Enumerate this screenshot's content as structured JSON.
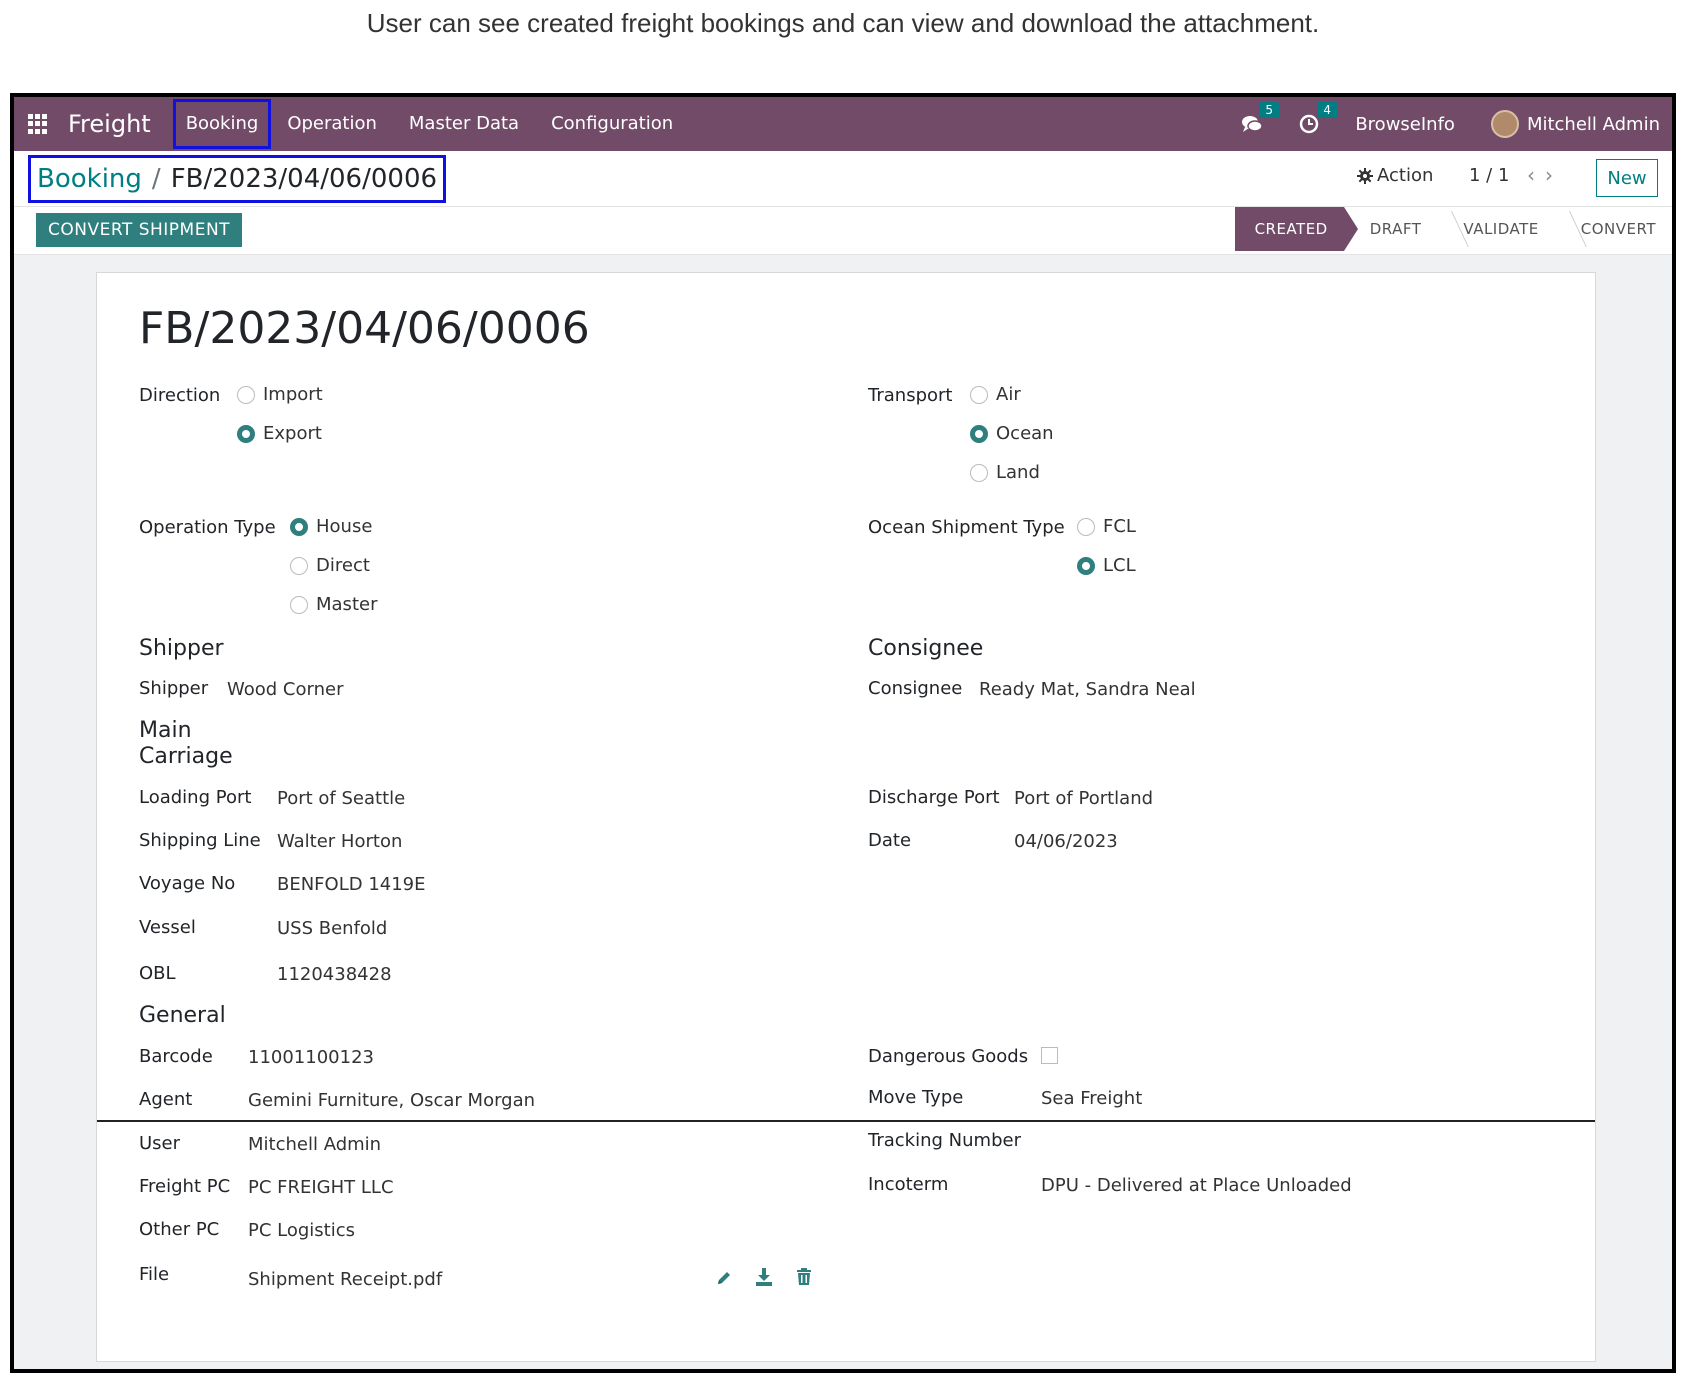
{
  "caption": "User can see created freight bookings and can view and download the attachment.",
  "navbar": {
    "brand": "Freight",
    "menu": [
      "Booking",
      "Operation",
      "Master Data",
      "Configuration"
    ],
    "messages_count": "5",
    "activities_count": "4",
    "company": "BrowseInfo",
    "user": "Mitchell Admin"
  },
  "control": {
    "breadcrumb_parent": "Booking",
    "breadcrumb_sep": "/",
    "breadcrumb_current": "FB/2023/04/06/0006",
    "action": "Action",
    "pager": "1 / 1",
    "new": "New"
  },
  "statusbar": {
    "convert_button": "CONVERT SHIPMENT",
    "stages": [
      "CREATED",
      "DRAFT",
      "VALIDATE",
      "CONVERT"
    ],
    "current_stage": "CREATED"
  },
  "form": {
    "title": "FB/2023/04/06/0006",
    "direction": {
      "label": "Direction",
      "options": [
        "Import",
        "Export"
      ],
      "selected": "Export"
    },
    "transport": {
      "label": "Transport",
      "options": [
        "Air",
        "Ocean",
        "Land"
      ],
      "selected": "Ocean"
    },
    "operation_type": {
      "label": "Operation Type",
      "options": [
        "House",
        "Direct",
        "Master"
      ],
      "selected": "House"
    },
    "ocean_shipment_type": {
      "label": "Ocean Shipment Type",
      "options": [
        "FCL",
        "LCL"
      ],
      "selected": "LCL"
    },
    "shipper_section": "Shipper",
    "shipper_label": "Shipper",
    "shipper_value": "Wood Corner",
    "consignee_section": "Consignee",
    "consignee_label": "Consignee",
    "consignee_value": "Ready Mat, Sandra Neal",
    "main_carriage_line1": "Main",
    "main_carriage_line2": "Carriage",
    "loading_port_label": "Loading Port",
    "loading_port_value": "Port of Seattle",
    "shipping_line_label": "Shipping Line",
    "shipping_line_value": "Walter Horton",
    "voyage_no_label": "Voyage No",
    "voyage_no_value": "BENFOLD 1419E",
    "vessel_label": "Vessel",
    "vessel_value": "USS Benfold",
    "obl_label": "OBL",
    "obl_value": "1120438428",
    "discharge_port_label": "Discharge Port",
    "discharge_port_value": "Port of Portland",
    "date_label": "Date",
    "date_value": "04/06/2023",
    "general_section": "General",
    "barcode_label": "Barcode",
    "barcode_value": "11001100123",
    "agent_label": "Agent",
    "agent_value": "Gemini Furniture, Oscar Morgan",
    "user_label": "User",
    "user_value": "Mitchell Admin",
    "freight_pc_label": "Freight PC",
    "freight_pc_value": "PC FREIGHT LLC",
    "other_pc_label": "Other PC",
    "other_pc_value": "PC Logistics",
    "file_label": "File",
    "file_value": "Shipment Receipt.pdf",
    "dangerous_goods_label": "Dangerous Goods",
    "dangerous_goods_checked": false,
    "move_type_label": "Move Type",
    "move_type_value": "Sea Freight",
    "tracking_number_label": "Tracking Number",
    "incoterm_label": "Incoterm",
    "incoterm_value": "DPU - Delivered at Place Unloaded"
  },
  "icons": {
    "apps": "apps-grid-icon",
    "messages": "chat-icon",
    "activities": "clock-icon",
    "action": "gear-icon",
    "edit": "pencil-icon",
    "download": "download-icon",
    "delete": "trash-icon"
  },
  "colors": {
    "navbar": "#714b67",
    "primary_button": "#2f7f7f",
    "link": "#017e84",
    "highlight_box": "#1010e0"
  }
}
